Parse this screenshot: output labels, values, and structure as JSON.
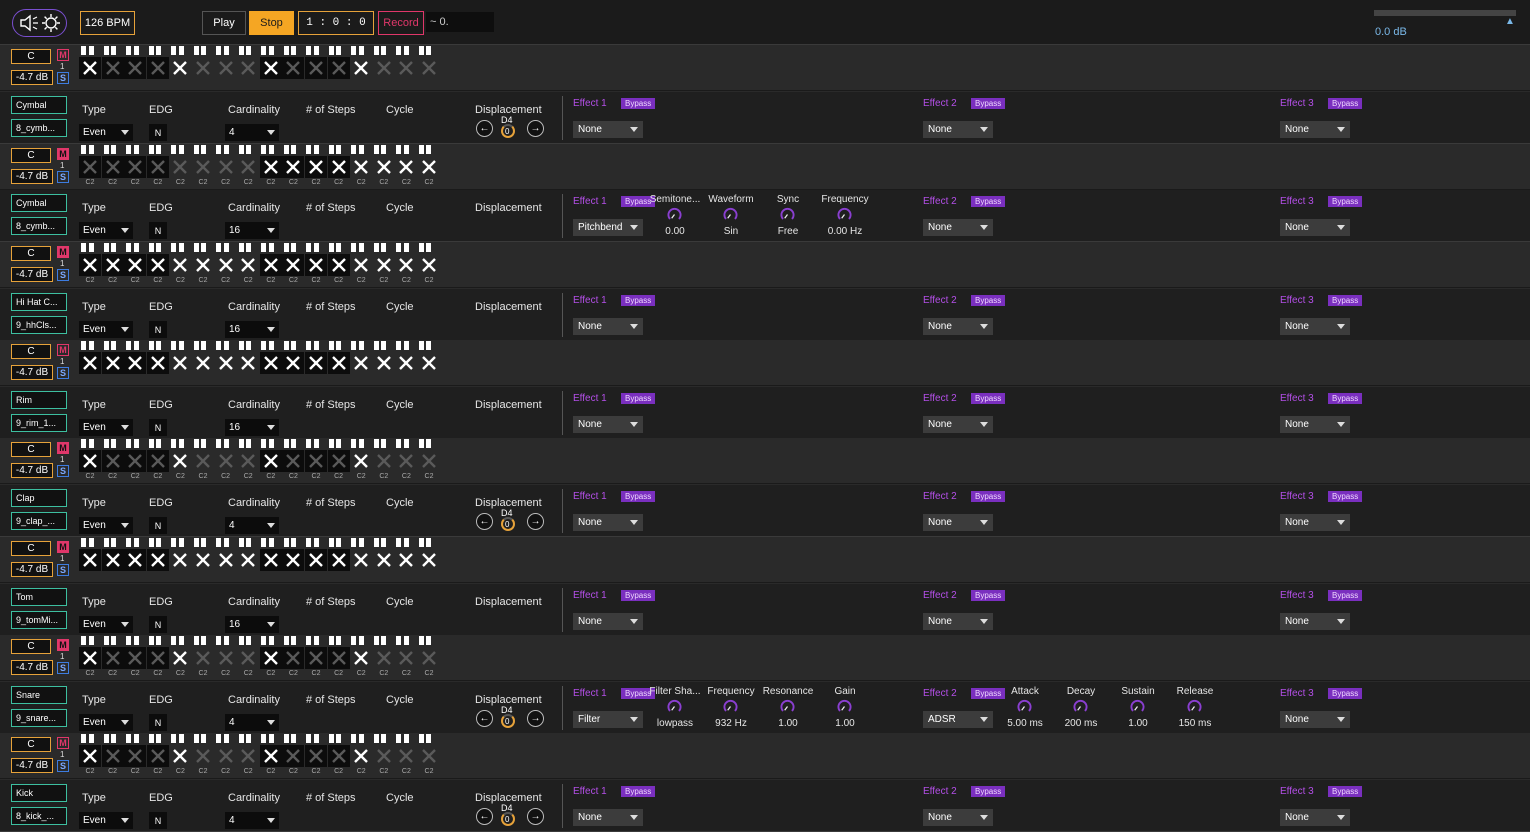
{
  "transport": {
    "bpm": "126 BPM",
    "play_label": "Play",
    "stop_label": "Stop",
    "position": "1 : 0 : 0",
    "record_label": "Record",
    "tilde_value": "~ 0.",
    "master_db": "0.0 dB"
  },
  "seq_label": "C2",
  "ctrl_labels": {
    "type": "Type",
    "edg": "EDG",
    "cardinality": "Cardinality",
    "steps": "# of Steps",
    "cycle": "Cycle",
    "displacement": "Displacement",
    "bypass": "Bypass"
  },
  "tracks": [
    {
      "seq": {
        "note": "C",
        "volume": "-4.7 dB",
        "mute_on": false,
        "show_c2": false,
        "steps": [
          1,
          0,
          0,
          0,
          1,
          0,
          0,
          0,
          1,
          0,
          0,
          0,
          1,
          0,
          0,
          0
        ]
      },
      "ctrl": {
        "name": "Cymbal",
        "file": "8_cymb...",
        "type": "Even",
        "edg": "N",
        "cardinality": "4",
        "displacement": true,
        "disp_note": "D4",
        "disp_val": "0",
        "effects": [
          {
            "label": "Effect 1",
            "value": "None",
            "params": []
          },
          {
            "label": "Effect 2",
            "value": "None",
            "params": []
          },
          {
            "label": "Effect 3",
            "value": "None",
            "params": []
          }
        ]
      }
    },
    {
      "seq": {
        "note": "C",
        "volume": "-4.7 dB",
        "mute_on": true,
        "show_c2": true,
        "steps": [
          0,
          0,
          0,
          0,
          0,
          0,
          0,
          0,
          1,
          1,
          1,
          1,
          1,
          1,
          1,
          1
        ]
      },
      "ctrl": {
        "name": "Cymbal",
        "file": "8_cymb...",
        "type": "Even",
        "edg": "N",
        "cardinality": "16",
        "displacement": false,
        "disp_note": "",
        "disp_val": "",
        "effects": [
          {
            "label": "Effect 1",
            "value": "Pitchbend",
            "params": [
              {
                "label": "Semitone...",
                "value": "0.00"
              },
              {
                "label": "Waveform",
                "value": "Sin"
              },
              {
                "label": "Sync",
                "value": "Free"
              },
              {
                "label": "Frequency",
                "value": "0.00 Hz"
              }
            ]
          },
          {
            "label": "Effect 2",
            "value": "None",
            "params": []
          },
          {
            "label": "Effect 3",
            "value": "None",
            "params": []
          }
        ]
      }
    },
    {
      "seq": {
        "note": "C",
        "volume": "-4.7 dB",
        "mute_on": true,
        "show_c2": true,
        "steps": [
          1,
          1,
          1,
          1,
          1,
          1,
          1,
          1,
          1,
          1,
          1,
          1,
          1,
          1,
          1,
          1
        ]
      },
      "ctrl": {
        "name": "Hi Hat C...",
        "file": "9_hhCls...",
        "type": "Even",
        "edg": "N",
        "cardinality": "16",
        "displacement": false,
        "disp_note": "",
        "disp_val": "",
        "effects": [
          {
            "label": "Effect 1",
            "value": "None",
            "params": []
          },
          {
            "label": "Effect 2",
            "value": "None",
            "params": []
          },
          {
            "label": "Effect 3",
            "value": "None",
            "params": []
          }
        ]
      }
    },
    {
      "seq": {
        "note": "C",
        "volume": "-4.7 dB",
        "mute_on": false,
        "show_c2": false,
        "steps": [
          1,
          1,
          1,
          1,
          1,
          1,
          1,
          1,
          1,
          1,
          1,
          1,
          1,
          1,
          1,
          1
        ]
      },
      "ctrl": {
        "name": "Rim",
        "file": "9_rim_1...",
        "type": "Even",
        "edg": "N",
        "cardinality": "16",
        "displacement": false,
        "disp_note": "",
        "disp_val": "",
        "effects": [
          {
            "label": "Effect 1",
            "value": "None",
            "params": []
          },
          {
            "label": "Effect 2",
            "value": "None",
            "params": []
          },
          {
            "label": "Effect 3",
            "value": "None",
            "params": []
          }
        ]
      }
    },
    {
      "seq": {
        "note": "C",
        "volume": "-4.7 dB",
        "mute_on": true,
        "show_c2": true,
        "steps": [
          1,
          0,
          0,
          0,
          1,
          0,
          0,
          0,
          1,
          0,
          0,
          0,
          1,
          0,
          0,
          0
        ]
      },
      "ctrl": {
        "name": "Clap",
        "file": "9_clap_...",
        "type": "Even",
        "edg": "N",
        "cardinality": "4",
        "displacement": true,
        "disp_note": "D4",
        "disp_val": "0",
        "effects": [
          {
            "label": "Effect 1",
            "value": "None",
            "params": []
          },
          {
            "label": "Effect 2",
            "value": "None",
            "params": []
          },
          {
            "label": "Effect 3",
            "value": "None",
            "params": []
          }
        ]
      }
    },
    {
      "seq": {
        "note": "C",
        "volume": "-4.7 dB",
        "mute_on": true,
        "show_c2": false,
        "steps": [
          1,
          1,
          1,
          1,
          1,
          1,
          1,
          1,
          1,
          1,
          1,
          1,
          1,
          1,
          1,
          1
        ]
      },
      "ctrl": {
        "name": "Tom",
        "file": "9_tomMi...",
        "type": "Even",
        "edg": "N",
        "cardinality": "16",
        "displacement": false,
        "disp_note": "",
        "disp_val": "",
        "effects": [
          {
            "label": "Effect 1",
            "value": "None",
            "params": []
          },
          {
            "label": "Effect 2",
            "value": "None",
            "params": []
          },
          {
            "label": "Effect 3",
            "value": "None",
            "params": []
          }
        ]
      }
    },
    {
      "seq": {
        "note": "C",
        "volume": "-4.7 dB",
        "mute_on": true,
        "show_c2": true,
        "steps": [
          1,
          0,
          0,
          0,
          1,
          0,
          0,
          0,
          1,
          0,
          0,
          0,
          1,
          0,
          0,
          0
        ]
      },
      "ctrl": {
        "name": "Snare",
        "file": "9_snare...",
        "type": "Even",
        "edg": "N",
        "cardinality": "4",
        "displacement": true,
        "disp_note": "D4",
        "disp_val": "0",
        "effects": [
          {
            "label": "Effect 1",
            "value": "Filter",
            "params": [
              {
                "label": "Filter Sha...",
                "value": "lowpass"
              },
              {
                "label": "Frequency",
                "value": "932 Hz"
              },
              {
                "label": "Resonance",
                "value": "1.00"
              },
              {
                "label": "Gain",
                "value": "1.00"
              }
            ]
          },
          {
            "label": "Effect 2",
            "value": "ADSR",
            "params": [
              {
                "label": "Attack",
                "value": "5.00 ms"
              },
              {
                "label": "Decay",
                "value": "200 ms"
              },
              {
                "label": "Sustain",
                "value": "1.00"
              },
              {
                "label": "Release",
                "value": "150 ms"
              }
            ]
          },
          {
            "label": "Effect 3",
            "value": "None",
            "params": []
          }
        ]
      }
    },
    {
      "seq": {
        "note": "C",
        "volume": "-4.7 dB",
        "mute_on": false,
        "show_c2": true,
        "steps": [
          1,
          0,
          0,
          0,
          1,
          0,
          0,
          0,
          1,
          0,
          0,
          0,
          1,
          0,
          0,
          0
        ]
      },
      "ctrl": {
        "name": "Kick",
        "file": "8_kick_...",
        "type": "Even",
        "edg": "N",
        "cardinality": "4",
        "displacement": true,
        "disp_note": "D4",
        "disp_val": "0",
        "effects": [
          {
            "label": "Effect 1",
            "value": "None",
            "params": []
          },
          {
            "label": "Effect 2",
            "value": "None",
            "params": []
          },
          {
            "label": "Effect 3",
            "value": "None",
            "params": []
          }
        ]
      }
    }
  ]
}
